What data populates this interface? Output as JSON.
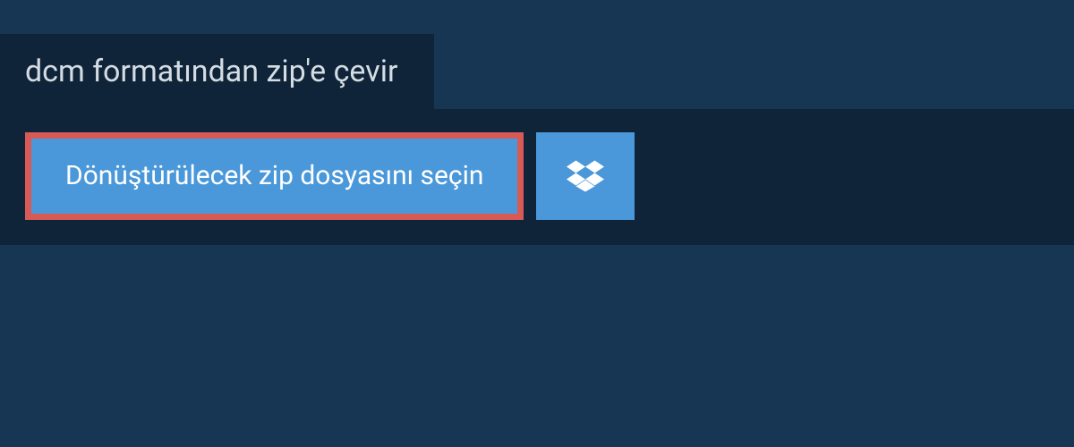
{
  "tab": {
    "title": "dcm formatından zip'e çevir"
  },
  "actions": {
    "select_file_label": "Dönüştürülecek zip dosyasını seçin",
    "dropbox_icon": "dropbox"
  },
  "colors": {
    "page_bg": "#173654",
    "panel_bg": "#0f2438",
    "button_bg": "#4a98d9",
    "highlight_border": "#d85a56",
    "text_light": "#d5dde4",
    "text_white": "#ffffff"
  }
}
